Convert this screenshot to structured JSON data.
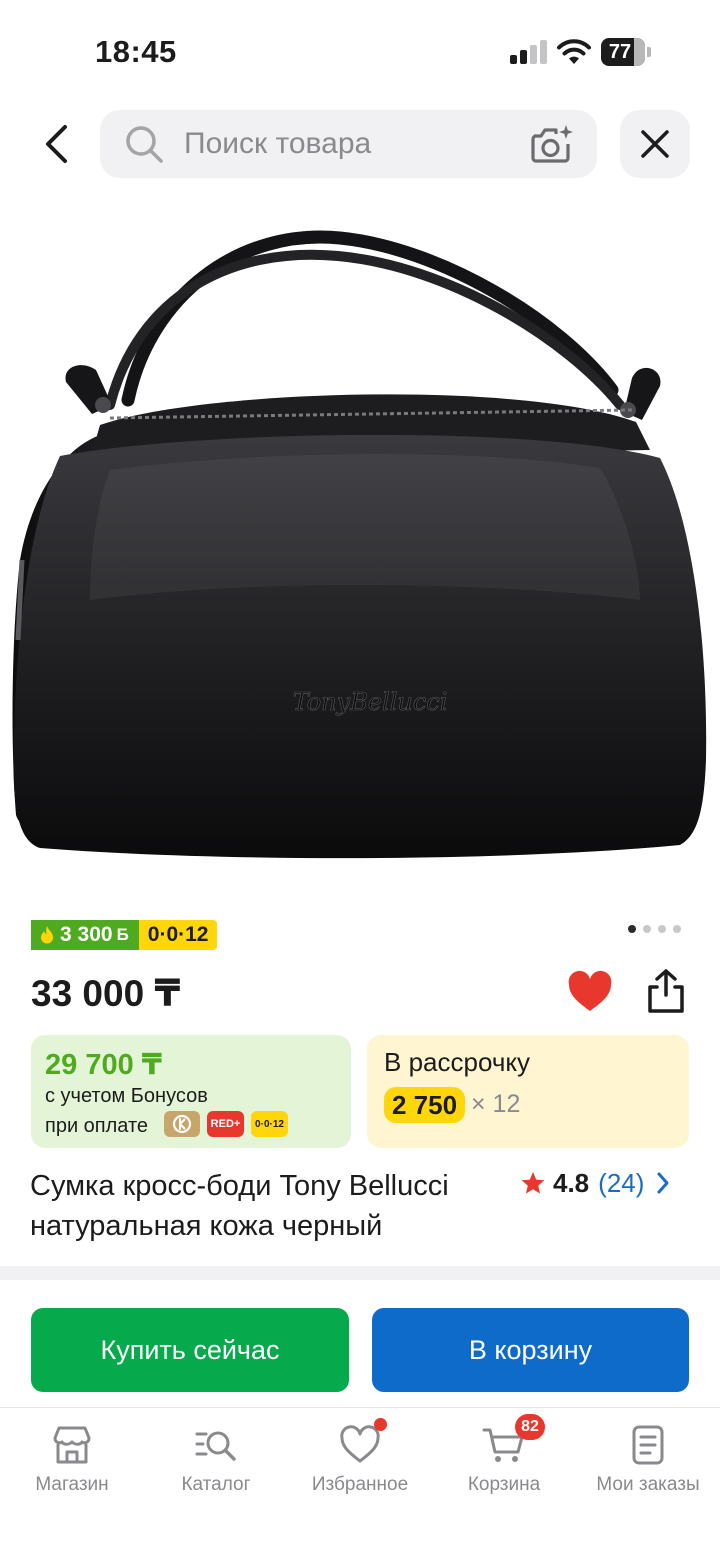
{
  "status_bar": {
    "time": "18:45",
    "battery": "77"
  },
  "search": {
    "placeholder": "Поиск товара"
  },
  "badges": {
    "bonus": "3 300",
    "bonus_currency": "Б",
    "installment": "0·0·12"
  },
  "product": {
    "price": "33 000 ₸",
    "title": "Сумка кросс-боди Tony Bellucci натуральная кожа черный",
    "brand_on_bag": "TonyBellucci",
    "image_count": 4,
    "image_index": 1,
    "favorited": true
  },
  "bonus_card": {
    "price": "29 700 ₸",
    "line1": "с учетом Бонусов",
    "line2": "при оплате",
    "pay_red": "RED+",
    "pay_inst": "0·0·12"
  },
  "installment_card": {
    "title": "В рассрочку",
    "amount": "2 750",
    "times": "× 12"
  },
  "rating": {
    "value": "4.8",
    "count": "(24)"
  },
  "actions": {
    "buy_now": "Купить сейчас",
    "add_to_cart": "В корзину"
  },
  "tabs": [
    {
      "label": "Магазин",
      "icon": "store-icon"
    },
    {
      "label": "Каталог",
      "icon": "catalog-icon"
    },
    {
      "label": "Избранное",
      "icon": "heart-icon"
    },
    {
      "label": "Корзина",
      "icon": "cart-icon",
      "badge": "82"
    },
    {
      "label": "Мои заказы",
      "icon": "orders-icon"
    }
  ],
  "colors": {
    "brand_green": "#4faa1f",
    "buy_button": "#06a94b",
    "cart_button": "#0e6bc9",
    "accent_yellow": "#ffd60a",
    "accent_red": "#e8382e",
    "link_blue": "#1b6dc1"
  }
}
